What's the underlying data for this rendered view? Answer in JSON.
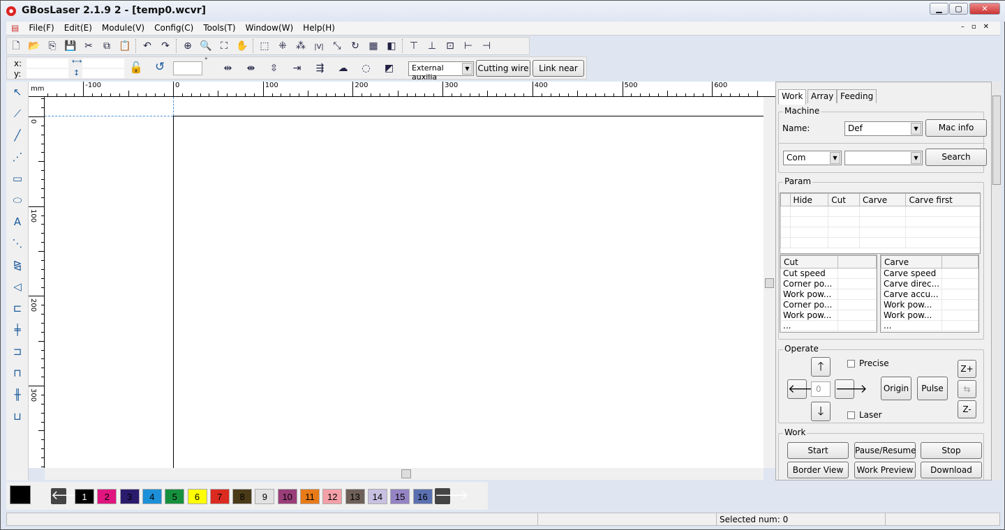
{
  "window": {
    "title": "GBosLaser 2.1.9 2 - [temp0.wcvr]",
    "controls": [
      "minimize-icon",
      "maximize-icon",
      "close-icon"
    ]
  },
  "menu": [
    "File(F)",
    "Edit(E)",
    "Module(V)",
    "Config(C)",
    "Tools(T)",
    "Window(W)",
    "Help(H)"
  ],
  "toolbar1": [
    [
      "new-icon",
      "🗋"
    ],
    [
      "open-icon",
      "📂"
    ],
    [
      "import-icon",
      "⎘"
    ],
    [
      "save-icon",
      "💾"
    ],
    [
      "cut-icon",
      "✂"
    ],
    [
      "copy-icon",
      "⧉"
    ],
    [
      "paste-icon",
      "📋"
    ],
    [
      "sep"
    ],
    [
      "undo-icon",
      "↶"
    ],
    [
      "redo-icon",
      "↷"
    ],
    [
      "sep"
    ],
    [
      "zoom-in-icon",
      "⊕"
    ],
    [
      "zoom-window-icon",
      "🔍"
    ],
    [
      "zoom-fit-icon",
      "⛶"
    ],
    [
      "pan-hand-icon",
      "✋"
    ],
    [
      "sep"
    ],
    [
      "select-group-icon",
      "⬚"
    ],
    [
      "ungroup-icon",
      "⁜"
    ],
    [
      "delete-nodes-icon",
      "⁂"
    ],
    [
      "mirror-icon",
      "|V|"
    ],
    [
      "path-direction-icon",
      "⤡"
    ],
    [
      "rotate-icon",
      "↻"
    ],
    [
      "grid-icon",
      "▦"
    ],
    [
      "array-icon",
      "◧"
    ],
    [
      "sep"
    ],
    [
      "align-top-icon",
      "⊤"
    ],
    [
      "align-bottom-icon",
      "⊥"
    ],
    [
      "align-center-icon",
      "⊡"
    ],
    [
      "align-left-icon",
      "⊢"
    ],
    [
      "align-right-icon",
      "⊣"
    ]
  ],
  "toolbar2": {
    "x_label": "x:",
    "y_label": "y:",
    "x_value": "",
    "y_value": "",
    "width_value": "",
    "height_value": "",
    "angle_value": "",
    "degree_symbol": "°",
    "icons": [
      [
        "distribute-h-icon",
        "⇹"
      ],
      [
        "distribute-center-icon",
        "⇼"
      ],
      [
        "distribute-v-icon",
        "⇳"
      ],
      [
        "lead-in-icon",
        "⇥"
      ],
      [
        "path-order-icon",
        "⇶"
      ],
      [
        "cloud-icon",
        "☁"
      ],
      [
        "circle-dashed-icon",
        "◌"
      ],
      [
        "optimize-icon",
        "◩"
      ]
    ],
    "mode_select": "External auxilia",
    "cutting_wire": "Cutting wire",
    "link_near": "Link near"
  },
  "ruler": {
    "unit": "mm",
    "h_ticks": [
      "-100",
      "0",
      "100",
      "200",
      "300",
      "400",
      "500",
      "600"
    ],
    "v_ticks": [
      "0",
      "100",
      "200",
      "300"
    ]
  },
  "left_tools": [
    [
      "select-arrow-icon",
      "↖"
    ],
    [
      "node-edit-icon",
      "⟋"
    ],
    [
      "line-icon",
      "╱"
    ],
    [
      "polyline-icon",
      "⋰"
    ],
    [
      "rectangle-icon",
      "▭"
    ],
    [
      "ellipse-icon",
      "⬭"
    ],
    [
      "text-icon",
      "A"
    ],
    [
      "measure-icon",
      "⋱"
    ],
    [
      "mirror-h-icon",
      "⧎"
    ],
    [
      "mirror-v-icon",
      "◁"
    ],
    [
      "align-left-tool-icon",
      "⊏"
    ],
    [
      "align-hcenter-tool-icon",
      "╪"
    ],
    [
      "align-right-tool-icon",
      "⊐"
    ],
    [
      "align-top-tool-icon",
      "⊓"
    ],
    [
      "align-vcenter-tool-icon",
      "╫"
    ],
    [
      "align-bottom-tool-icon",
      "⊔"
    ]
  ],
  "panel": {
    "tabs": [
      "Work",
      "Array",
      "Feeding"
    ],
    "active_tab": "Work",
    "machine": {
      "label": "Machine",
      "name_label": "Name:",
      "name_value": "Def",
      "mac_info": "Mac info",
      "port_value": "Com",
      "port2_value": "",
      "search": "Search"
    },
    "param": {
      "label": "Param",
      "columns": [
        "",
        "Hide",
        "Cut",
        "Carve",
        "Carve first"
      ],
      "cut": {
        "header": "Cut",
        "rows": [
          "Cut speed",
          "Corner po...",
          "Work pow...",
          "Corner po...",
          "Work pow...",
          "..."
        ]
      },
      "carve": {
        "header": "Carve",
        "rows": [
          "Carve speed",
          "Carve direc...",
          "Carve accu...",
          "Work pow...",
          "Work pow...",
          "..."
        ]
      }
    },
    "operate": {
      "label": "Operate",
      "precise": "Precise",
      "laser": "Laser",
      "precise_checked": false,
      "laser_checked": false,
      "step_value": "0",
      "origin": "Origin",
      "pulse": "Pulse",
      "z_plus": "Z+",
      "z_minus": "Z-"
    },
    "work": {
      "label": "Work",
      "start": "Start",
      "pause": "Pause/Resume",
      "stop": "Stop",
      "border_view": "Border View",
      "work_preview": "Work Preview",
      "download": "Download"
    }
  },
  "palette": {
    "current_color": "#000000",
    "layers": [
      {
        "n": "1",
        "c": "#000000",
        "t": "#ffffff"
      },
      {
        "n": "2",
        "c": "#e0157f",
        "t": "#000"
      },
      {
        "n": "3",
        "c": "#2b1b6c",
        "t": "#000"
      },
      {
        "n": "4",
        "c": "#1c90d8",
        "t": "#000"
      },
      {
        "n": "5",
        "c": "#17903e",
        "t": "#000"
      },
      {
        "n": "6",
        "c": "#ffff00",
        "t": "#000"
      },
      {
        "n": "7",
        "c": "#db2a20",
        "t": "#000"
      },
      {
        "n": "8",
        "c": "#4a3a18",
        "t": "#000"
      },
      {
        "n": "9",
        "c": "#e2e2e2",
        "t": "#000"
      },
      {
        "n": "10",
        "c": "#9a3e7a",
        "t": "#000"
      },
      {
        "n": "11",
        "c": "#e87a18",
        "t": "#000"
      },
      {
        "n": "12",
        "c": "#f4a0a8",
        "t": "#000"
      },
      {
        "n": "13",
        "c": "#6e6058",
        "t": "#000"
      },
      {
        "n": "14",
        "c": "#c8c0e0",
        "t": "#000"
      },
      {
        "n": "15",
        "c": "#9484c4",
        "t": "#000"
      },
      {
        "n": "16",
        "c": "#5a70b0",
        "t": "#000"
      }
    ]
  },
  "status": {
    "selected": "Selected num: 0"
  }
}
